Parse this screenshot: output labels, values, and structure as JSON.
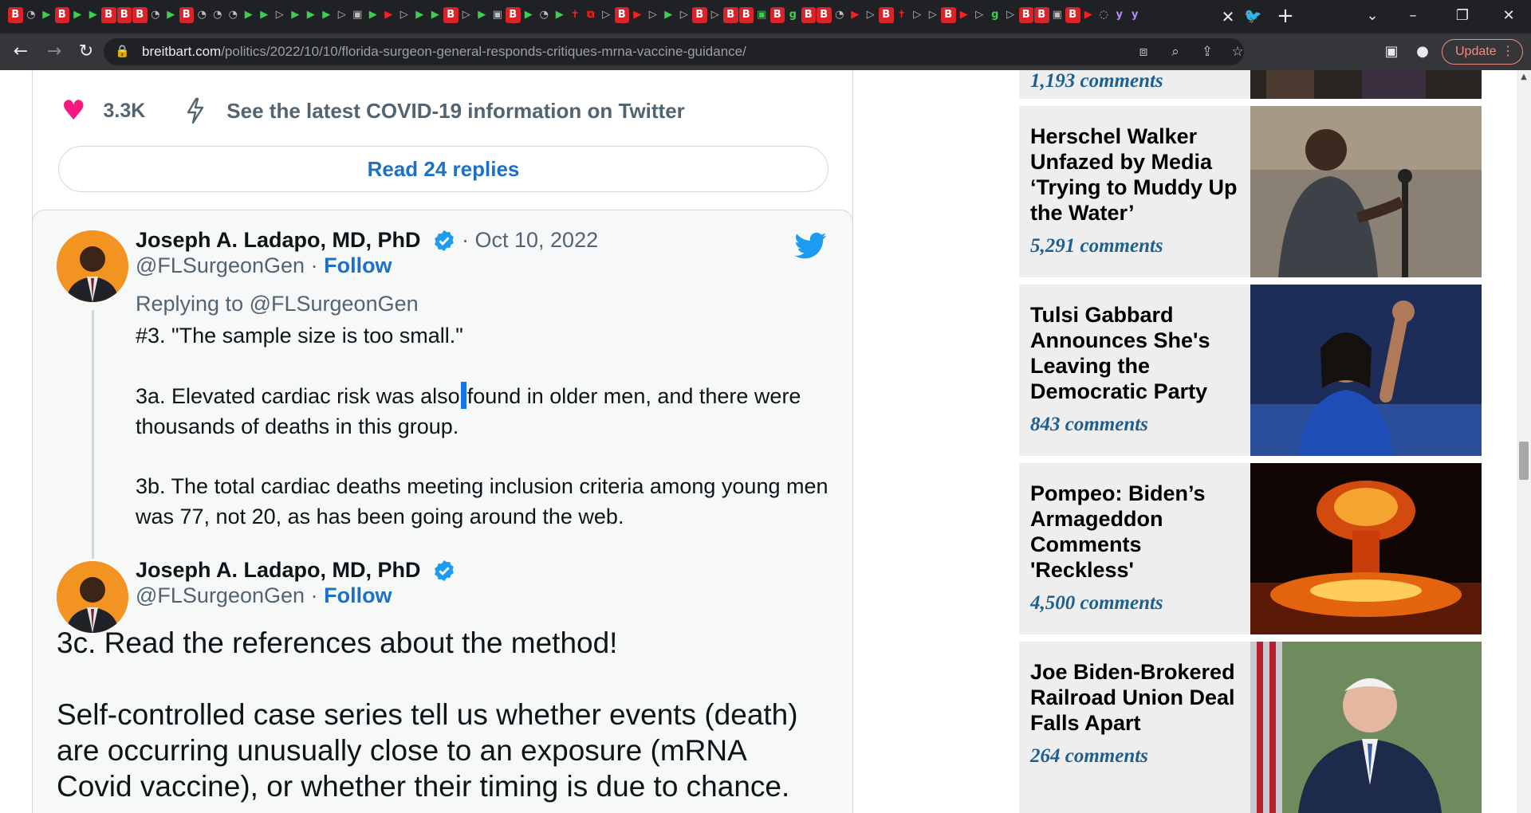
{
  "browser": {
    "url_host": "breitbart.com",
    "url_path": "/politics/2022/10/10/florida-surgeon-general-responds-critiques-mrna-vaccine-guidance/",
    "update_label": "Update",
    "tab_close_glyph": "✕",
    "new_tab_glyph": "+"
  },
  "tweet_prev": {
    "likes": "3.3K",
    "covid_link": "See the latest COVID-19 information on Twitter",
    "read_replies": "Read 24 replies"
  },
  "tweet_main": {
    "author": "Joseph A. Ladapo, MD, PhD",
    "date": "· Oct 10, 2022",
    "handle": "@FLSurgeonGen",
    "separator": "·",
    "follow": "Follow",
    "replying_to": "Replying to @FLSurgeonGen",
    "p1": "#3. \"The sample size is too small.\"",
    "p2_before": "3a. Elevated cardiac risk was also",
    "p2_after": "found in older men, and there were thousands of deaths in this group.",
    "p3": "3b. The total cardiac deaths meeting inclusion criteria among young men was 77, not 20, as has been going around the web."
  },
  "tweet_quoted": {
    "author": "Joseph A. Ladapo, MD, PhD",
    "handle": "@FLSurgeonGen",
    "separator": "·",
    "follow": "Follow",
    "p1": "3c. Read the references about the method!",
    "p2": "Self-controlled case series tell us whether events (death) are occurring unusually close to an exposure (mRNA Covid vaccine), or whether their timing is due to chance."
  },
  "sidebar": {
    "partial_comments": "1,193 comments",
    "items": [
      {
        "title": "Herschel Walker Unfazed by Media ‘Trying to Muddy Up the Water’",
        "comments": "5,291 comments"
      },
      {
        "title": "Tulsi Gabbard Announces She's Leaving the Democratic Party",
        "comments": "843 comments"
      },
      {
        "title": "Pompeo: Biden’s Armageddon Comments 'Reckless'",
        "comments": "4,500 comments"
      },
      {
        "title": "Joe Biden-Brokered Railroad Union Deal Falls Apart",
        "comments": "264 comments"
      }
    ]
  }
}
